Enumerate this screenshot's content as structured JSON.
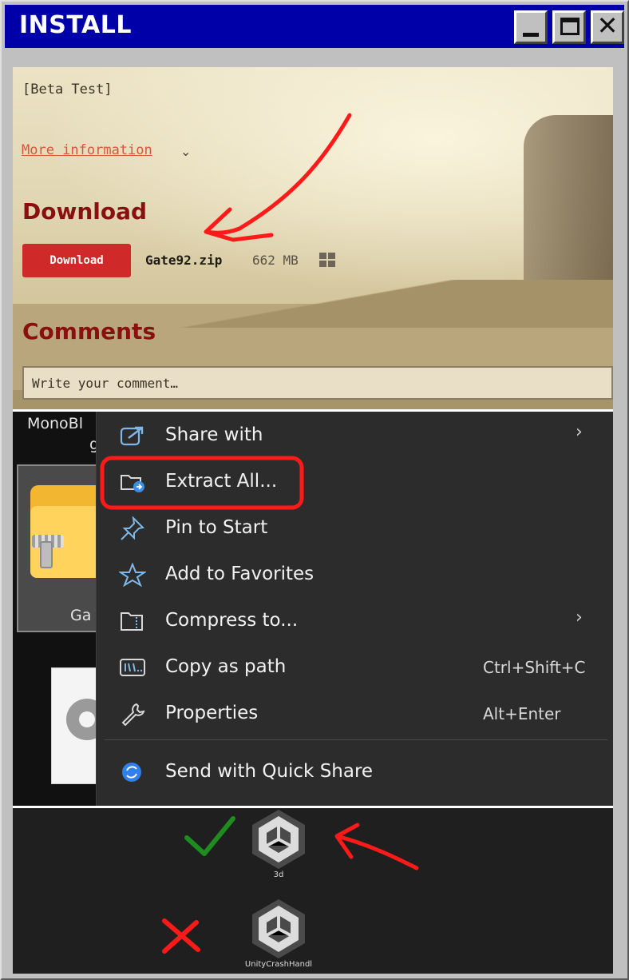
{
  "window": {
    "title": "INSTALL"
  },
  "page": {
    "beta_text": "[Beta Test]",
    "more_info_link": "More information",
    "download_heading": "Download",
    "download_button": "Download",
    "file_name": "Gate92.zip",
    "file_size": "662 MB",
    "platform_icon": "windows-icon",
    "comments_heading": "Comments",
    "comment_placeholder": "Write your comment…"
  },
  "desktop": {
    "item1_label_a": "MonoBl",
    "item1_label_b": "g",
    "zip_label": "Ga",
    "unity_3d_label": "3d",
    "unity_crash_label": "UnityCrashHandl"
  },
  "context_menu": {
    "items": [
      {
        "label": "Share with",
        "icon": "share-icon",
        "shortcut": "",
        "submenu": true
      },
      {
        "label": "Extract All...",
        "icon": "extract-folder-icon",
        "shortcut": "",
        "submenu": false
      },
      {
        "label": "Pin to Start",
        "icon": "pin-icon",
        "shortcut": "",
        "submenu": false
      },
      {
        "label": "Add to Favorites",
        "icon": "star-icon",
        "shortcut": "",
        "submenu": false
      },
      {
        "label": "Compress to...",
        "icon": "compress-folder-icon",
        "shortcut": "",
        "submenu": true
      },
      {
        "label": "Copy as path",
        "icon": "copy-path-icon",
        "shortcut": "Ctrl+Shift+C",
        "submenu": false
      },
      {
        "label": "Properties",
        "icon": "wrench-icon",
        "shortcut": "Alt+Enter",
        "submenu": false
      },
      {
        "label": "Send with Quick Share",
        "icon": "quick-share-icon",
        "shortcut": "",
        "submenu": false
      }
    ]
  },
  "colors": {
    "title_bar": "#0000a8",
    "heading_red": "#8a0f0f",
    "download_button": "#d02929",
    "annotation_red": "#ff0000",
    "check_green": "#1e8c1e",
    "menu_bg": "#2c2c2c"
  }
}
